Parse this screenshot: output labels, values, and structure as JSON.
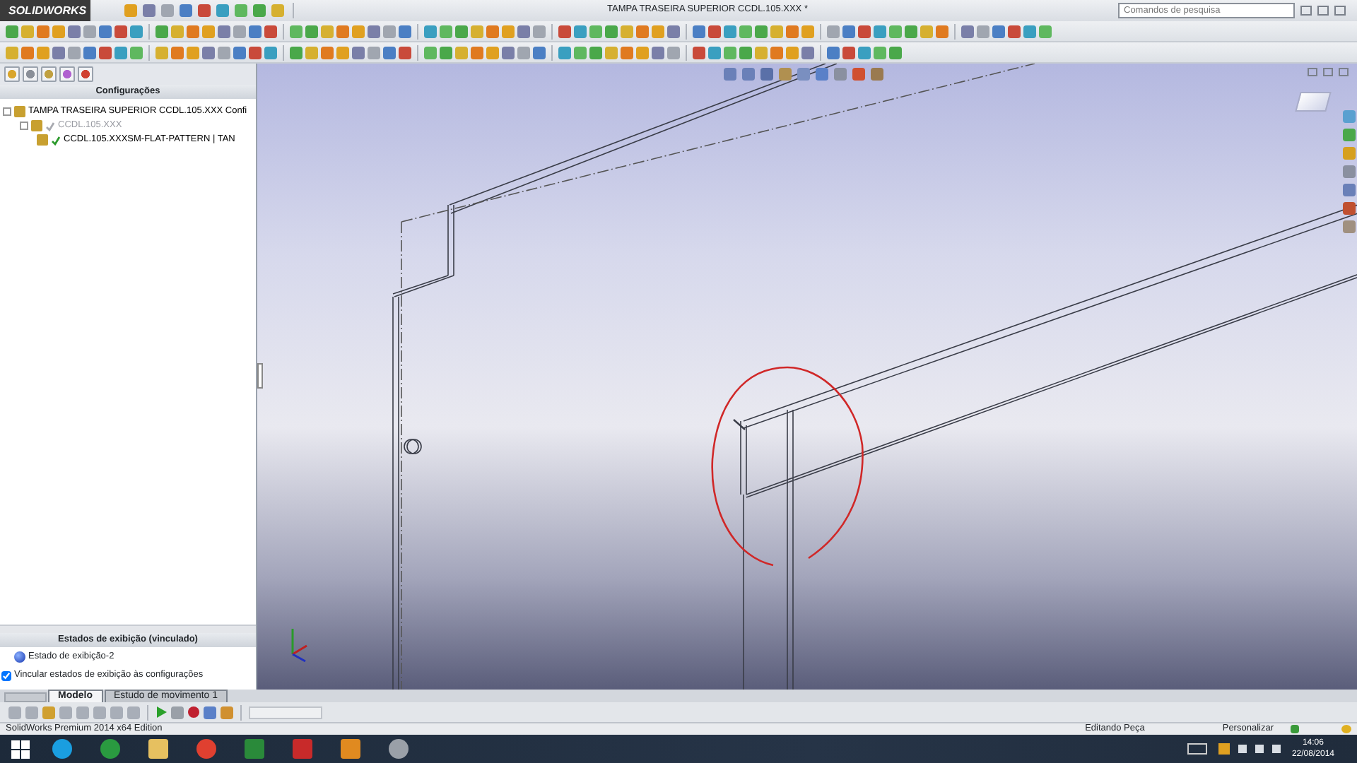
{
  "window": {
    "logo": "SOLIDWORKS",
    "title": "TAMPA TRASEIRA SUPERIOR CCDL.105.XXX *"
  },
  "search": {
    "placeholder": "Comandos de pesquisa"
  },
  "feature_manager": {
    "header": "Configurações",
    "tree": [
      {
        "label": "TAMPA TRASEIRA SUPERIOR CCDL.105.XXX Confi",
        "expanded": true,
        "children": [
          {
            "label": "CCDL.105.XXX",
            "active": false,
            "expanded": true,
            "children": [
              {
                "label": "CCDL.105.XXXSM-FLAT-PATTERN | TAN",
                "active": true
              }
            ]
          }
        ]
      }
    ]
  },
  "display_states": {
    "header": "Estados de exibição (vinculado)",
    "items": [
      {
        "label": "Estado de exibição-2"
      }
    ],
    "link_option": {
      "label": "Vincular estados de exibição às configurações",
      "checked": true
    }
  },
  "bottom_tabs": [
    {
      "label": "Modelo",
      "selected": true
    },
    {
      "label": "Estudo de movimento 1",
      "selected": false
    }
  ],
  "status_bar": {
    "product": "SolidWorks Premium 2014 x64 Edition",
    "mode": "Editando Peça",
    "units": "Personalizar"
  },
  "taskbar": {
    "time": "14:06",
    "date": "22/08/2014"
  }
}
